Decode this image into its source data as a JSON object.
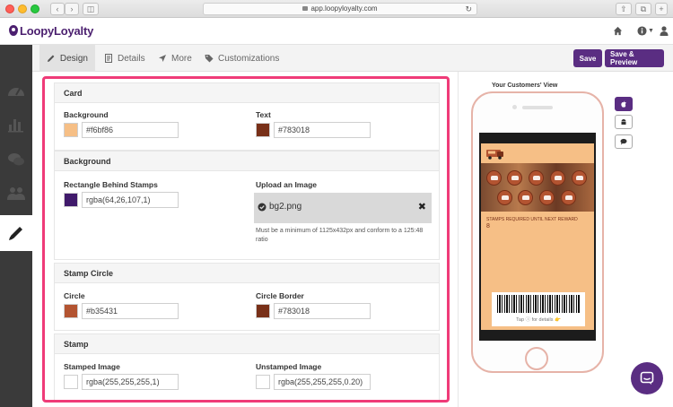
{
  "browser": {
    "url": "app.loopyloyalty.com"
  },
  "app": {
    "name": "LoopyLoyalty"
  },
  "tabs": [
    {
      "label": "Design"
    },
    {
      "label": "Details"
    },
    {
      "label": "More"
    },
    {
      "label": "Customizations"
    }
  ],
  "buttons": {
    "save": "Save",
    "save_preview": "Save & Preview"
  },
  "sections": {
    "card": {
      "title": "Card",
      "background_label": "Background",
      "background_value": "#f6bf86",
      "background_color": "#f6bf86",
      "text_label": "Text",
      "text_value": "#783018",
      "text_color": "#783018"
    },
    "background": {
      "title": "Background",
      "rect_label": "Rectangle Behind Stamps",
      "rect_value": "rgba(64,26,107,1)",
      "rect_color": "#401a6b",
      "upload_label": "Upload an Image",
      "upload_file": "bg2.png",
      "upload_hint": "Must be a minimum of 1125x432px and conform to a 125:48 ratio"
    },
    "stamp_circle": {
      "title": "Stamp Circle",
      "circle_label": "Circle",
      "circle_value": "#b35431",
      "circle_color": "#b35431",
      "border_label": "Circle Border",
      "border_value": "#783018",
      "border_color": "#783018"
    },
    "stamp": {
      "title": "Stamp",
      "stamped_label": "Stamped Image",
      "stamped_value": "rgba(255,255,255,1)",
      "unstamped_label": "Unstamped Image",
      "unstamped_value": "rgba(255,255,255,0.20)"
    }
  },
  "preview": {
    "title": "Your Customers' View",
    "stamps_label": "STAMPS REQUIRED UNTIL NEXT REWARD",
    "stamps_count": "8",
    "tap_text": "Tap ⓘ for details 👉"
  },
  "icons": {
    "home": "home-icon",
    "info": "info-icon",
    "user": "user-icon",
    "chat": "chat-icon"
  }
}
